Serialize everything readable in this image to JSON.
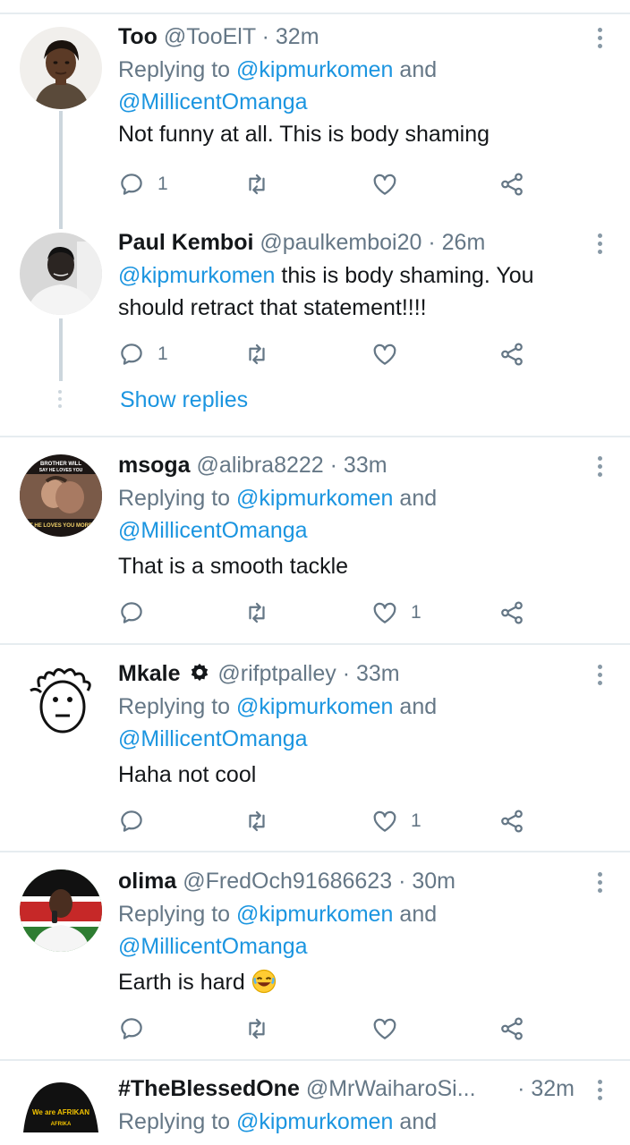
{
  "icons": {
    "reply": "reply-icon",
    "retweet": "retweet-icon",
    "like": "heart-icon",
    "share": "share-icon",
    "more": "more-vertical-icon"
  },
  "colors": {
    "link": "#1b95e0",
    "secondary": "#657786",
    "border": "#e6ecf0"
  },
  "tweets": [
    {
      "name": "Too",
      "handle": "@TooElT",
      "dot": "·",
      "time": "32m",
      "replying_prefix": "Replying to ",
      "replying_mention": "@kipmurkomen",
      "replying_and": " and",
      "replying_mention2": "@MillicentOmanga",
      "body": "Not funny at all. This is body shaming",
      "reply_count": "1",
      "retweet_count": "",
      "like_count": ""
    },
    {
      "name": "Paul Kemboi",
      "handle": "@paulkemboi20",
      "dot": "·",
      "time": "26m",
      "body_mention": "@kipmurkomen",
      "body": " this is body shaming. You should retract that statement!!!!",
      "reply_count": "1",
      "retweet_count": "",
      "like_count": ""
    },
    {
      "name": "msoga",
      "handle": "@alibra8222",
      "dot": "·",
      "time": "33m",
      "replying_prefix": "Replying to ",
      "replying_mention": "@kipmurkomen",
      "replying_and": " and",
      "replying_mention2": "@MillicentOmanga",
      "body": "That is a smooth tackle",
      "reply_count": "",
      "retweet_count": "",
      "like_count": "1"
    },
    {
      "name": "Mkale",
      "handle": "@rifptpalley",
      "dot": "·",
      "time": "33m",
      "replying_prefix": "Replying to ",
      "replying_mention": "@kipmurkomen",
      "replying_and": " and",
      "replying_mention2": "@MillicentOmanga",
      "body": "Haha not cool",
      "reply_count": "",
      "retweet_count": "",
      "like_count": "1"
    },
    {
      "name": "olima",
      "handle": "@FredOch91686623",
      "dot": "·",
      "time": "30m",
      "replying_prefix": "Replying to ",
      "replying_mention": "@kipmurkomen",
      "replying_and": " and",
      "replying_mention2": "@MillicentOmanga",
      "body": "Earth is hard",
      "reply_count": "",
      "retweet_count": "",
      "like_count": ""
    },
    {
      "name": "#TheBlessedOne",
      "handle": "@MrWaiharoSi...",
      "dot": "·",
      "time": "32m",
      "replying_prefix": "Replying to ",
      "replying_mention": "@kipmurkomen",
      "replying_and": " and"
    }
  ],
  "show_replies": "Show replies",
  "avatar_texts": {
    "msoga_top": "BROTHER WILL",
    "msoga_top2": "SAY HE LOVES YOU",
    "msoga_bottom": "T HE LOVES YOU MORE",
    "blessed_1": "We are AFRIKAN",
    "blessed_2": "AFRIKA"
  }
}
